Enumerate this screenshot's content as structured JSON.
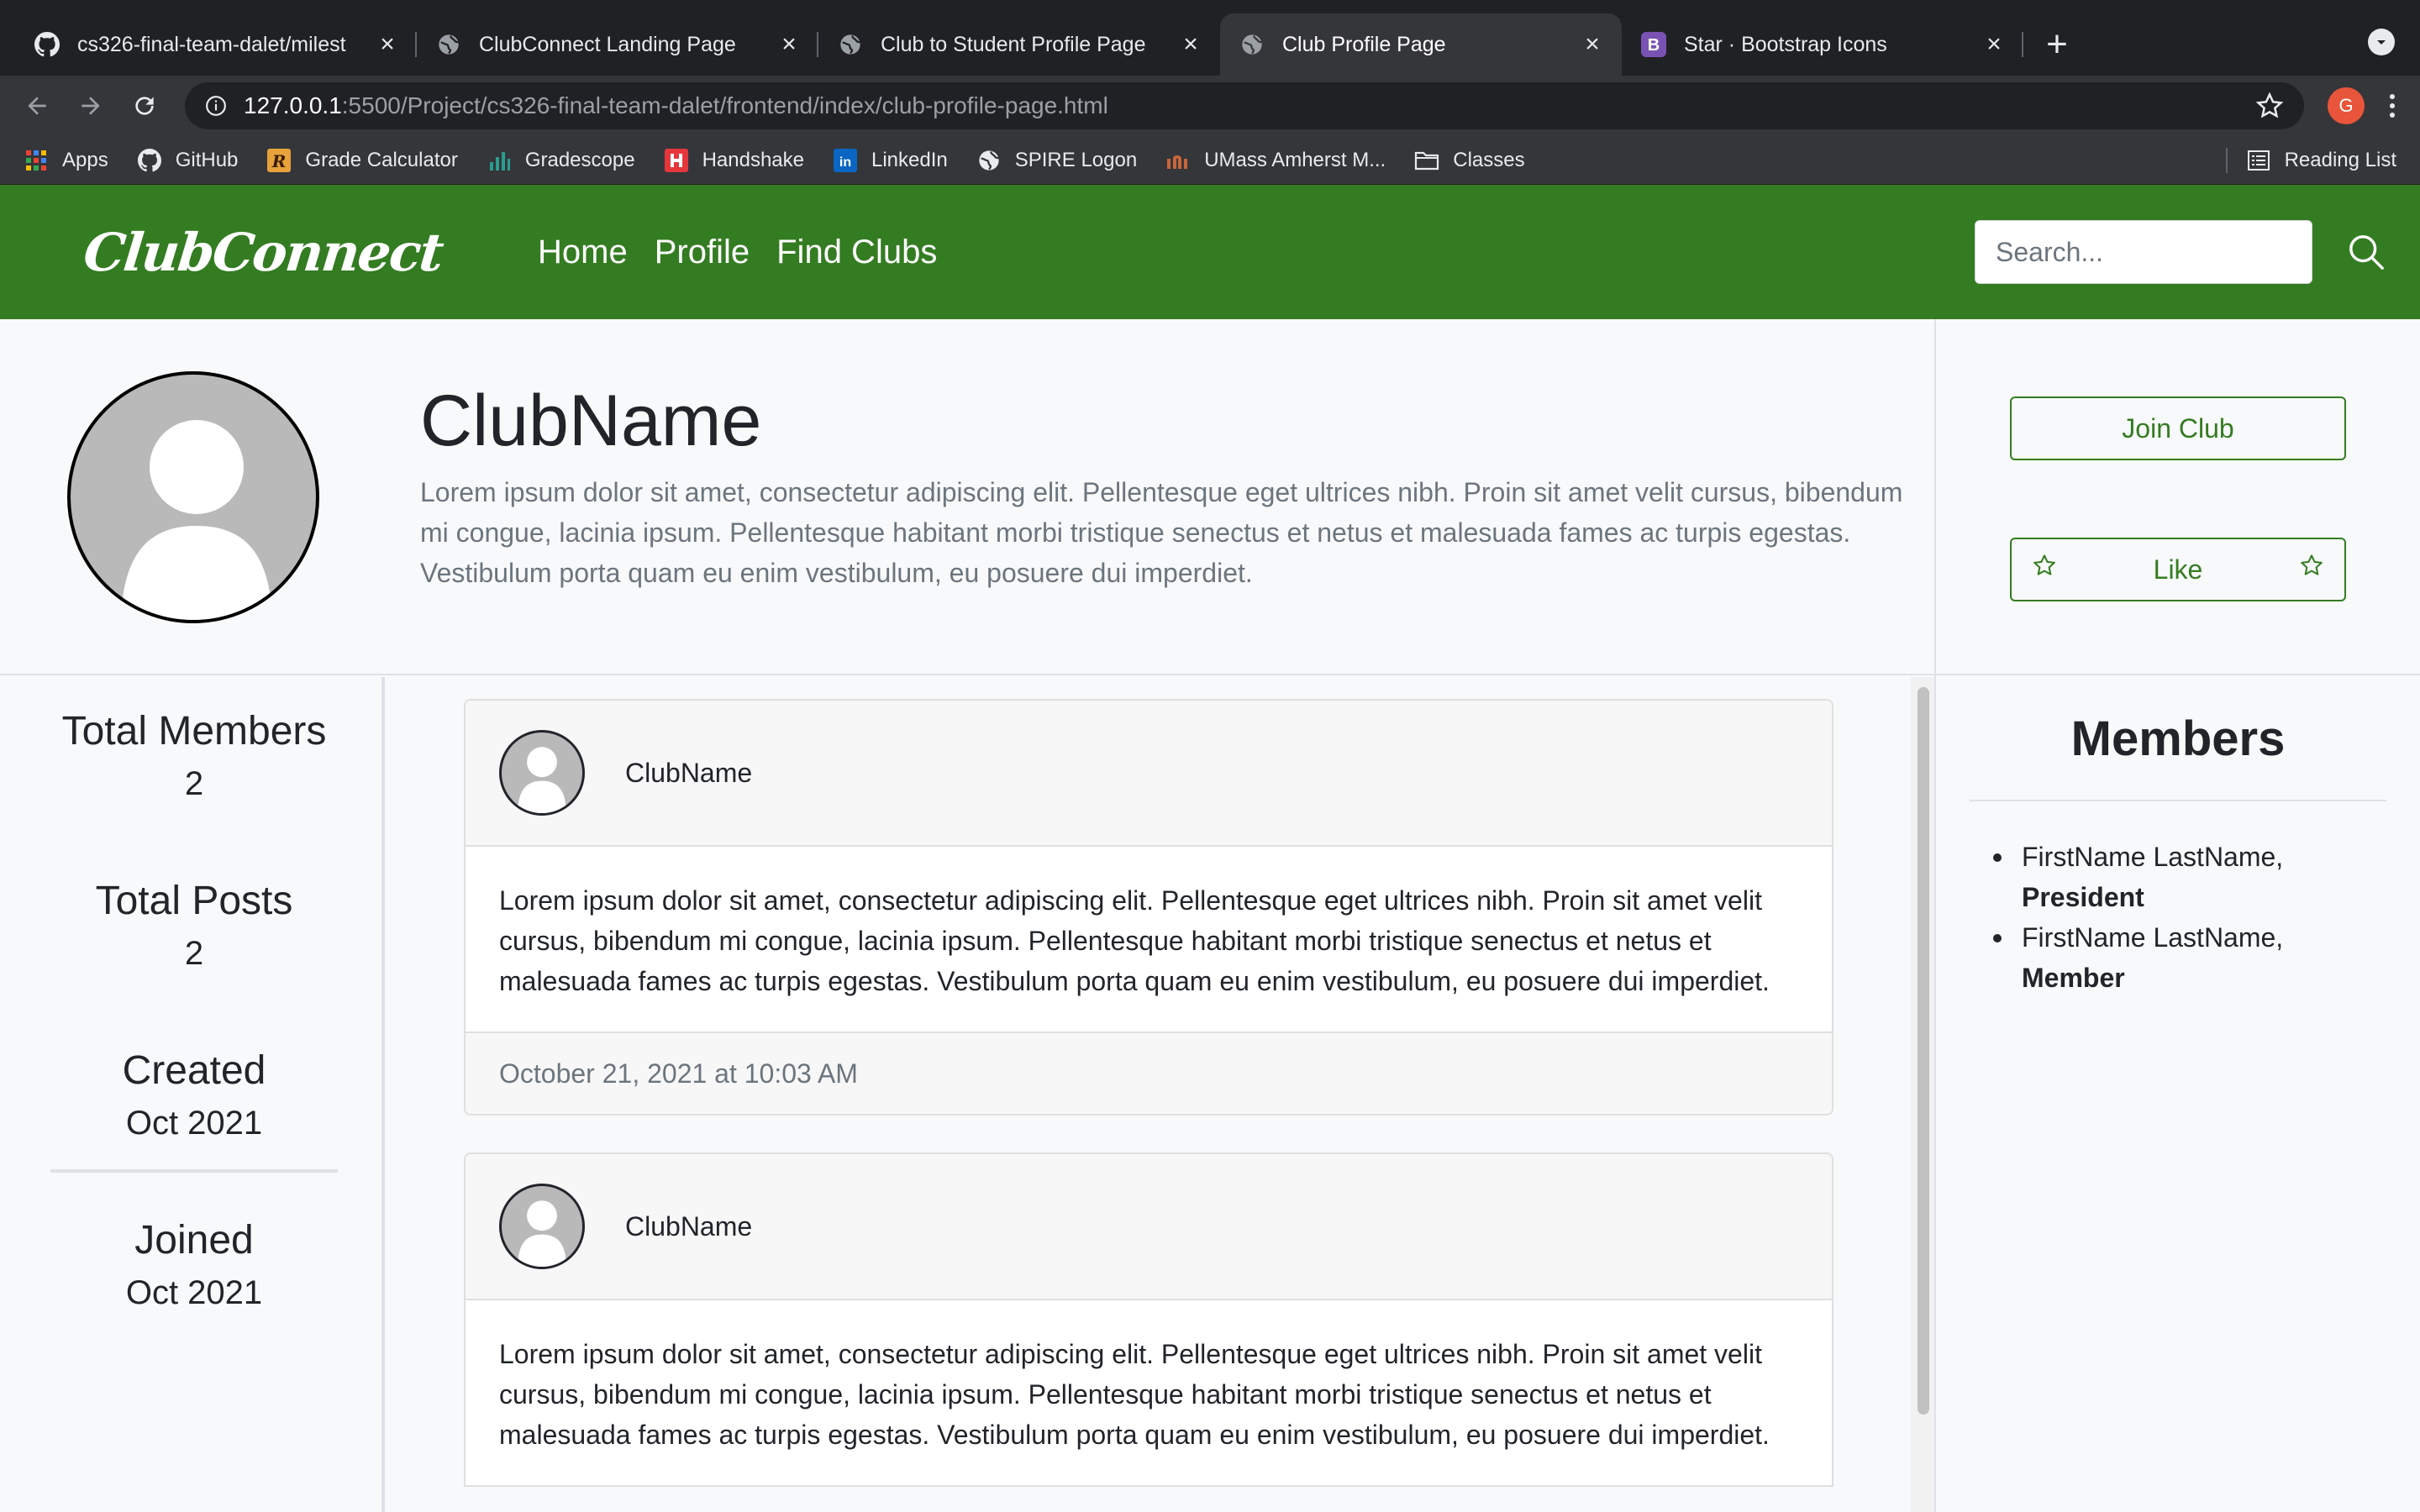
{
  "browser": {
    "tabs": [
      {
        "title": "cs326-final-team-dalet/milest",
        "icon": "github-icon"
      },
      {
        "title": "ClubConnect Landing Page",
        "icon": "globe-icon"
      },
      {
        "title": "Club to Student Profile Page",
        "icon": "globe-icon"
      },
      {
        "title": "Club Profile Page",
        "icon": "globe-icon",
        "active": true
      },
      {
        "title": "Star · Bootstrap Icons",
        "icon": "bootstrap-icon"
      }
    ],
    "url_host": "127.0.0.1",
    "url_path": ":5500/Project/cs326-final-team-dalet/frontend/index/club-profile-page.html",
    "profile_initial": "G",
    "bookmarks": [
      {
        "label": "Apps",
        "icon": "apps-grid-icon"
      },
      {
        "label": "GitHub",
        "icon": "github-icon"
      },
      {
        "label": "Grade Calculator",
        "icon": "grade-calculator-icon"
      },
      {
        "label": "Gradescope",
        "icon": "gradescope-icon"
      },
      {
        "label": "Handshake",
        "icon": "handshake-icon"
      },
      {
        "label": "LinkedIn",
        "icon": "linkedin-icon"
      },
      {
        "label": "SPIRE Logon",
        "icon": "globe-icon"
      },
      {
        "label": "UMass Amherst M...",
        "icon": "umass-icon"
      },
      {
        "label": "Classes",
        "icon": "folder-icon"
      }
    ],
    "reading_list": "Reading List"
  },
  "site": {
    "brand": "ClubConnect",
    "nav": [
      "Home",
      "Profile",
      "Find Clubs"
    ],
    "search_placeholder": "Search...",
    "colors": {
      "brand_green": "#347c22"
    }
  },
  "club": {
    "name": "ClubName",
    "description": "Lorem ipsum dolor sit amet, consectetur adipiscing elit. Pellentesque eget ultrices nibh. Proin sit amet velit cursus, bibendum mi congue, lacinia ipsum. Pellentesque habitant morbi tristique senectus et netus et malesuada fames ac turpis egestas. Vestibulum porta quam eu enim vestibulum, eu posuere dui imperdiet.",
    "join_label": "Join Club",
    "like_label": "Like"
  },
  "stats": [
    {
      "label": "Total Members",
      "value": "2"
    },
    {
      "label": "Total Posts",
      "value": "2"
    },
    {
      "label": "Created",
      "value": "Oct 2021"
    },
    {
      "label": "Joined",
      "value": "Oct 2021"
    }
  ],
  "posts": [
    {
      "author": "ClubName",
      "body": "Lorem ipsum dolor sit amet, consectetur adipiscing elit. Pellentesque eget ultrices nibh. Proin sit amet velit cursus, bibendum mi congue, lacinia ipsum. Pellentesque habitant morbi tristique senectus et netus et malesuada fames ac turpis egestas. Vestibulum porta quam eu enim vestibulum, eu posuere dui imperdiet.",
      "timestamp": "October 21, 2021 at 10:03 AM"
    },
    {
      "author": "ClubName",
      "body": "Lorem ipsum dolor sit amet, consectetur adipiscing elit. Pellentesque eget ultrices nibh. Proin sit amet velit cursus, bibendum mi congue, lacinia ipsum. Pellentesque habitant morbi tristique senectus et netus et malesuada fames ac turpis egestas. Vestibulum porta quam eu enim vestibulum, eu posuere dui imperdiet."
    }
  ],
  "members": {
    "title": "Members",
    "list": [
      {
        "name": "FirstName LastName,",
        "role": "President"
      },
      {
        "name": "FirstName LastName,",
        "role": "Member"
      }
    ]
  }
}
